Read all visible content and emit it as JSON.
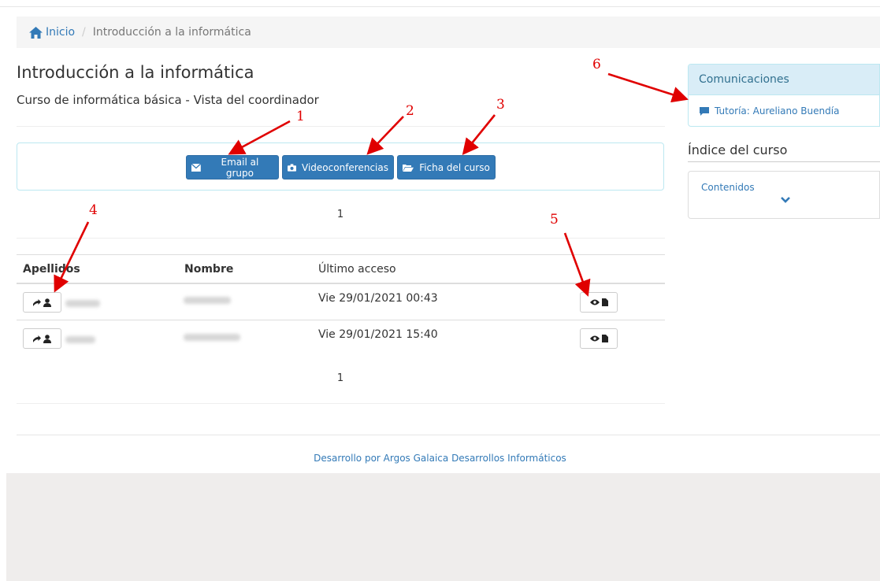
{
  "breadcrumb": {
    "home": "Inicio",
    "current": "Introducción a la informática"
  },
  "page": {
    "title": "Introducción a la informática",
    "subtitle": "Curso de informática básica - Vista del coordinador"
  },
  "toolbar": {
    "email_label": "Email al grupo",
    "video_label": "Videoconferencias",
    "ficha_label": "Ficha del curso"
  },
  "pagination": {
    "top": "1",
    "bottom": "1"
  },
  "table": {
    "headers": {
      "apellidos": "Apellidos",
      "nombre": "Nombre",
      "ultimo_acceso": "Último acceso"
    },
    "rows": [
      {
        "apellidos": "",
        "nombre": "",
        "ultimo_acceso": "Vie 29/01/2021 00:43"
      },
      {
        "apellidos": "",
        "nombre": "",
        "ultimo_acceso": "Vie 29/01/2021 15:40"
      }
    ]
  },
  "footer": {
    "text": "Desarrollo por Argos Galaica Desarrollos Informáticos"
  },
  "sidebar": {
    "comunicaciones_title": "Comunicaciones",
    "tutoria_label": "Tutoría: Aureliano Buendía",
    "indice_title": "Índice del curso",
    "contenidos_label": "Contenidos"
  },
  "annotations": [
    "1",
    "2",
    "3",
    "4",
    "5",
    "6"
  ],
  "colors": {
    "primary": "#337ab7",
    "annotation": "#e00000",
    "info_bg": "#d9edf7",
    "info_border": "#bce8f1"
  },
  "icons": [
    "home-icon",
    "envelope-icon",
    "camera-icon",
    "folder-open-icon",
    "arrow-right-icon",
    "user-icon",
    "eye-icon",
    "file-icon",
    "comment-icon",
    "chevron-down-icon"
  ]
}
